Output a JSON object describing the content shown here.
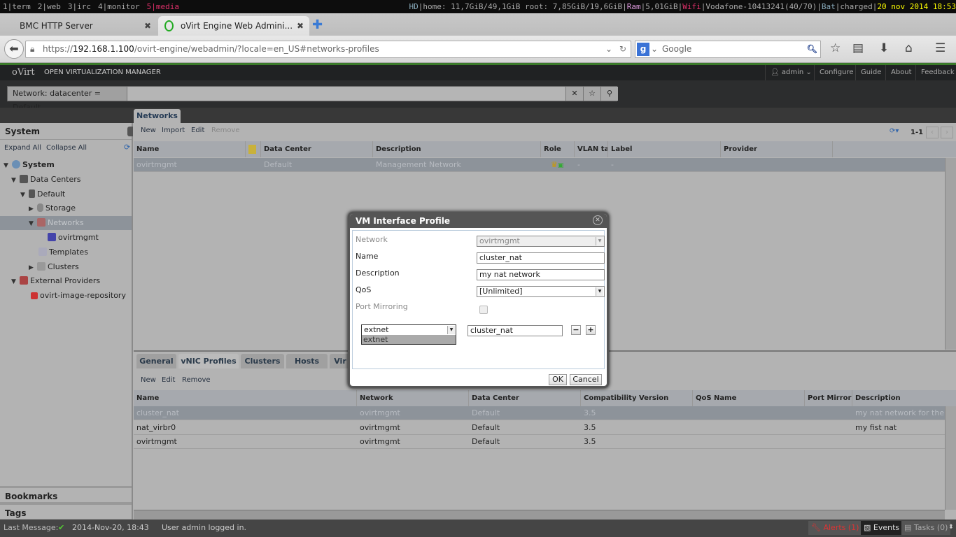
{
  "wm": {
    "workspaces": [
      {
        "label": "1|term",
        "color": "#aaaaaa"
      },
      {
        "label": "2|web",
        "color": "#aaaaaa"
      },
      {
        "label": "3|irc",
        "color": "#aaaaaa"
      },
      {
        "label": "4|monitor",
        "color": "#aaaaaa"
      },
      {
        "label": "5|media",
        "color": "#e0306a"
      }
    ],
    "status": {
      "hd": "HD",
      "home": "|home: 11,7GiB/49,1GiB  root: 7,85GiB/19,6GiB|",
      "ram": "Ram",
      "ram_val": "|5,01GiB|",
      "wifi": "Wifi",
      "wifi_val": "|Vodafone-10413241(40/70)|",
      "bat": "Bat",
      "bat_val": "|charged|",
      "clock": "20 nov 2014 18:53"
    }
  },
  "browser": {
    "tabs": [
      {
        "title": "BMC HTTP Server"
      },
      {
        "title": "oVirt Engine Web Admini..."
      }
    ],
    "url_scheme": "https://",
    "url_host": "192.168.1.100",
    "url_path": "/ovirt-engine/webadmin/?locale=en_US#networks-profiles",
    "search_placeholder": "Google"
  },
  "app": {
    "logo": "oVirt",
    "title": "OPEN VIRTUALIZATION MANAGER",
    "user": "admin",
    "menu": [
      "Configure",
      "Guide",
      "About",
      "Feedback"
    ],
    "search_query": "Network: datacenter = Default",
    "main_tab": "Networks"
  },
  "sidebar": {
    "title": "System",
    "expand_all": "Expand All",
    "collapse_all": "Collapse All",
    "tree": [
      "System",
      "Data Centers",
      "Default",
      "Storage",
      "Networks",
      "ovirtmgmt",
      "Templates",
      "Clusters",
      "External Providers",
      "ovirt-image-repository"
    ],
    "bookmarks": "Bookmarks",
    "tags": "Tags"
  },
  "networks": {
    "actions": [
      "New",
      "Import",
      "Edit",
      "Remove"
    ],
    "paging": "1-1",
    "columns": [
      "Name",
      "",
      "Data Center",
      "Description",
      "Role",
      "VLAN tag",
      "Label",
      "Provider"
    ],
    "rows": [
      {
        "name": "ovirtmgmt",
        "dc": "Default",
        "desc": "Management Network",
        "vlan": "-",
        "label": "-"
      }
    ]
  },
  "detail": {
    "tabs": [
      "General",
      "vNIC Profiles",
      "Clusters",
      "Hosts",
      "Vir"
    ],
    "actions": [
      "New",
      "Edit",
      "Remove"
    ],
    "columns": [
      "Name",
      "Network",
      "Data Center",
      "Compatibility Version",
      "QoS Name",
      "Port Mirroring",
      "Description"
    ],
    "rows": [
      {
        "name": "cluster_nat",
        "network": "ovirtmgmt",
        "dc": "Default",
        "ver": "3.5",
        "qos": "",
        "pm": "",
        "desc": "my nat network for the cl"
      },
      {
        "name": "nat_virbr0",
        "network": "ovirtmgmt",
        "dc": "Default",
        "ver": "3.5",
        "qos": "",
        "pm": "",
        "desc": "my fist nat"
      },
      {
        "name": "ovirtmgmt",
        "network": "ovirtmgmt",
        "dc": "Default",
        "ver": "3.5",
        "qos": "",
        "pm": "",
        "desc": ""
      }
    ]
  },
  "dialog": {
    "title": "VM Interface Profile",
    "network_label": "Network",
    "network_value": "ovirtmgmt",
    "name_label": "Name",
    "name_value": "cluster_nat",
    "desc_label": "Description",
    "desc_value": "my nat network",
    "qos_label": "QoS",
    "qos_value": "[Unlimited]",
    "pm_label": "Port Mirroring",
    "pm_checked": false,
    "provider_value": "extnet",
    "provider_option": "extnet",
    "profile_value": "cluster_nat",
    "ok": "OK",
    "cancel": "Cancel"
  },
  "statusbar": {
    "label": "Last Message:",
    "time": "2014-Nov-20, 18:43",
    "message": "User admin logged in.",
    "alerts": "Alerts (1)",
    "events": "Events",
    "tasks": "Tasks (0)"
  }
}
